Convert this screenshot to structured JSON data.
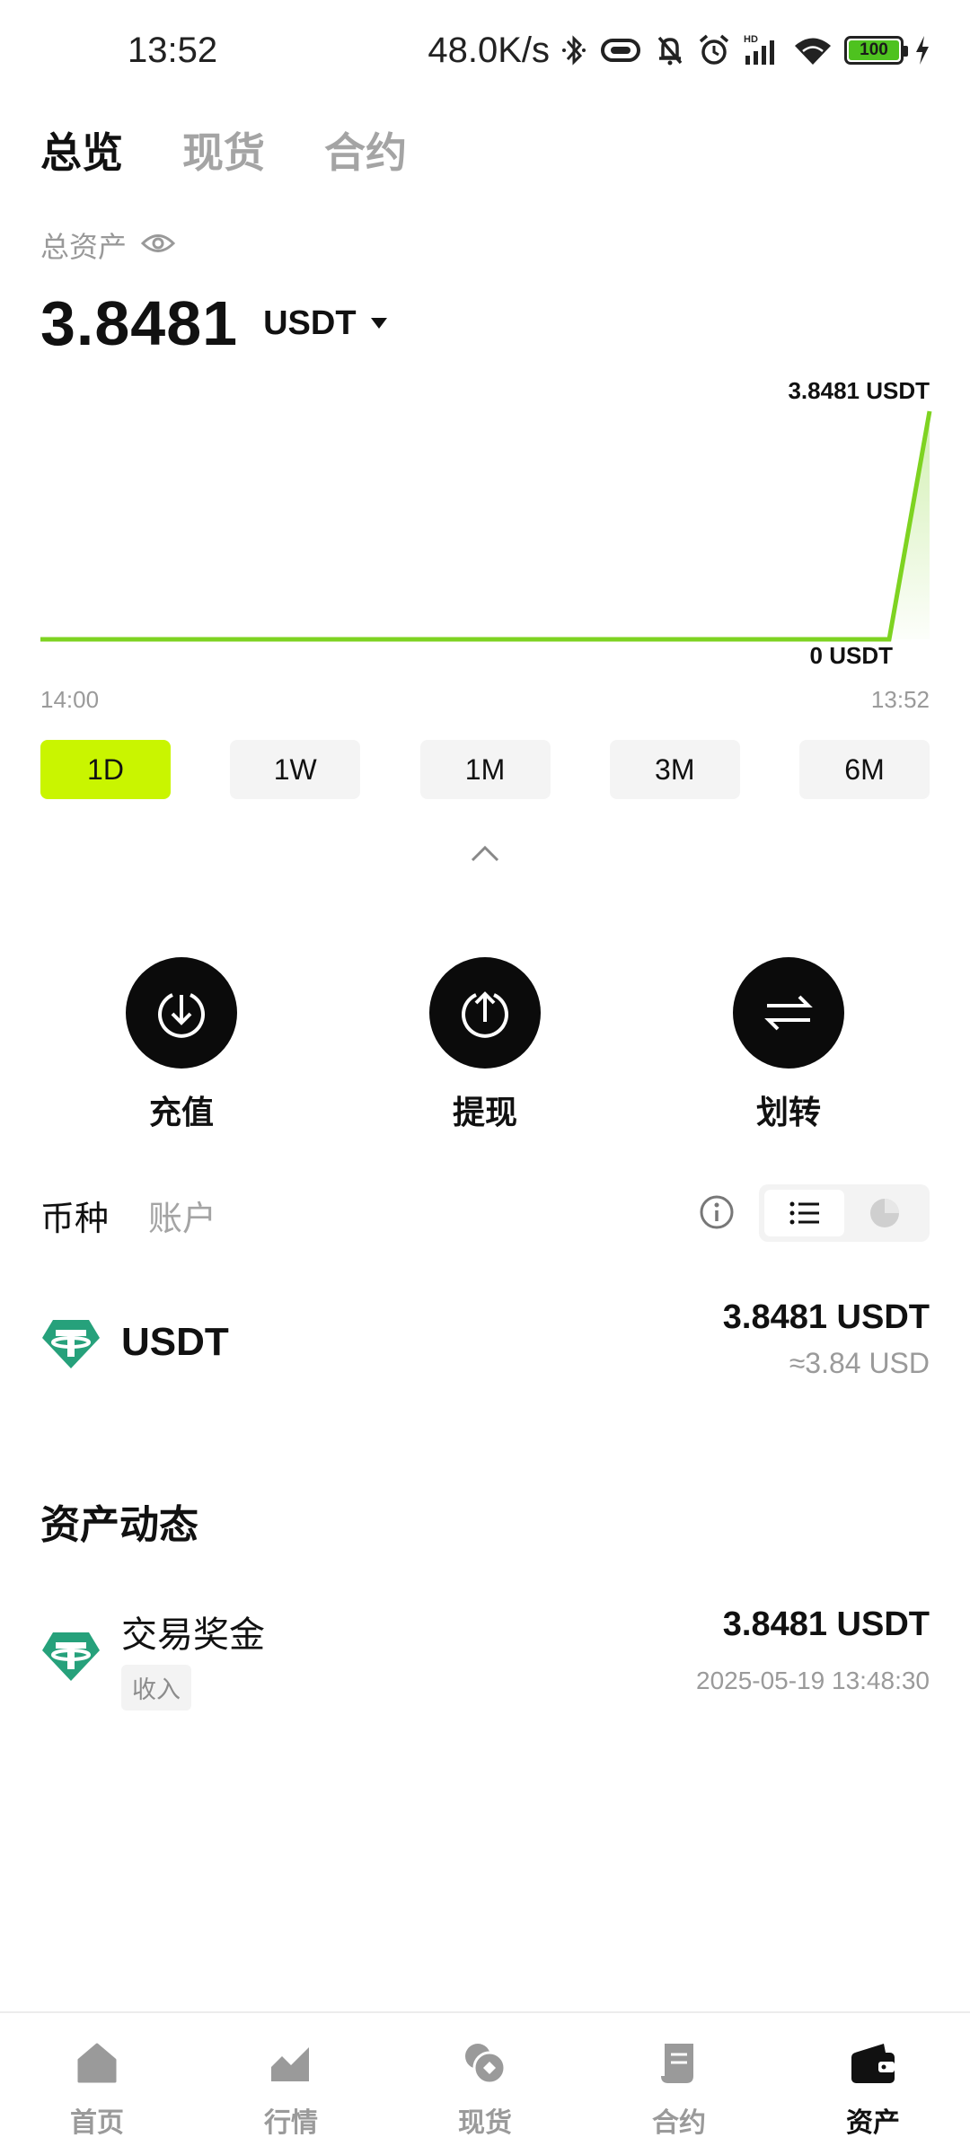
{
  "status_bar": {
    "time": "13:52",
    "net_speed": "48.0K/s",
    "battery": "100",
    "icons": [
      "bluetooth-icon",
      "vibrate-icon",
      "mute-icon",
      "alarm-icon",
      "signal-icon",
      "wifi-icon",
      "battery-icon",
      "charging-icon"
    ]
  },
  "top_tabs": [
    {
      "label": "总览",
      "active": true
    },
    {
      "label": "现货",
      "active": false
    },
    {
      "label": "合约",
      "active": false
    }
  ],
  "total_assets": {
    "label": "总资产",
    "value": "3.8481",
    "currency": "USDT"
  },
  "chart_data": {
    "type": "area",
    "x": [
      "14:00",
      "13:52"
    ],
    "values": [
      0,
      0,
      3.8481
    ],
    "max_label": "3.8481 USDT",
    "min_label": "0 USDT",
    "x_start_label": "14:00",
    "x_end_label": "13:52",
    "ylim": [
      0,
      3.8481
    ],
    "color": "#7ed321"
  },
  "periods": [
    {
      "label": "1D",
      "active": true
    },
    {
      "label": "1W",
      "active": false
    },
    {
      "label": "1M",
      "active": false
    },
    {
      "label": "3M",
      "active": false
    },
    {
      "label": "6M",
      "active": false
    }
  ],
  "actions": [
    {
      "label": "充值",
      "icon": "deposit-icon"
    },
    {
      "label": "提现",
      "icon": "withdraw-icon"
    },
    {
      "label": "划转",
      "icon": "transfer-icon"
    }
  ],
  "sub_tabs": [
    {
      "label": "币种",
      "active": true
    },
    {
      "label": "账户",
      "active": false
    }
  ],
  "coins": [
    {
      "name": "USDT",
      "amount": "3.8481 USDT",
      "usd": "≈3.84 USD",
      "icon": "tether-icon"
    }
  ],
  "activity": {
    "title": "资产动态",
    "items": [
      {
        "name": "交易奖金",
        "badge": "收入",
        "amount": "3.8481 USDT",
        "time": "2025-05-19 13:48:30",
        "icon": "tether-icon"
      }
    ]
  },
  "bottom_nav": [
    {
      "label": "首页",
      "icon": "home-icon",
      "active": false
    },
    {
      "label": "行情",
      "icon": "market-icon",
      "active": false
    },
    {
      "label": "现货",
      "icon": "spot-icon",
      "active": false
    },
    {
      "label": "合约",
      "icon": "contract-icon",
      "active": false
    },
    {
      "label": "资产",
      "icon": "wallet-icon",
      "active": true
    }
  ],
  "colors": {
    "accent": "#c9f500",
    "chart_line": "#7ed321",
    "tether": "#26a17b"
  }
}
